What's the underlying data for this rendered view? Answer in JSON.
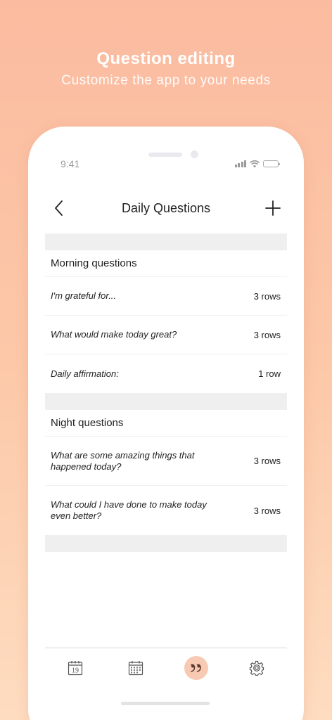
{
  "promo": {
    "title": "Question editing",
    "subtitle": "Customize the app to your needs"
  },
  "status_bar": {
    "time": "9:41"
  },
  "navbar": {
    "title": "Daily Questions"
  },
  "sections": [
    {
      "title": "Morning questions",
      "rows": [
        {
          "question": "I'm grateful for...",
          "count": "3 rows"
        },
        {
          "question": "What would make today great?",
          "count": "3 rows"
        },
        {
          "question": "Daily affirmation:",
          "count": "1 row"
        }
      ]
    },
    {
      "title": "Night questions",
      "rows": [
        {
          "question": "What are some amazing things that happened today?",
          "count": "3 rows"
        },
        {
          "question": "What could I have done to make today even better?",
          "count": "3 rows"
        }
      ]
    }
  ],
  "tabbar": {
    "calendar_day": "19",
    "items": [
      "calendar-day-icon",
      "calendar-month-icon",
      "quote-icon",
      "gear-icon"
    ],
    "active": "quote-icon"
  },
  "colors": {
    "background_top": "#fbbba0",
    "background_bottom": "#fedcc0",
    "accent": "#f8c9b3",
    "section_gap": "#efefef"
  }
}
